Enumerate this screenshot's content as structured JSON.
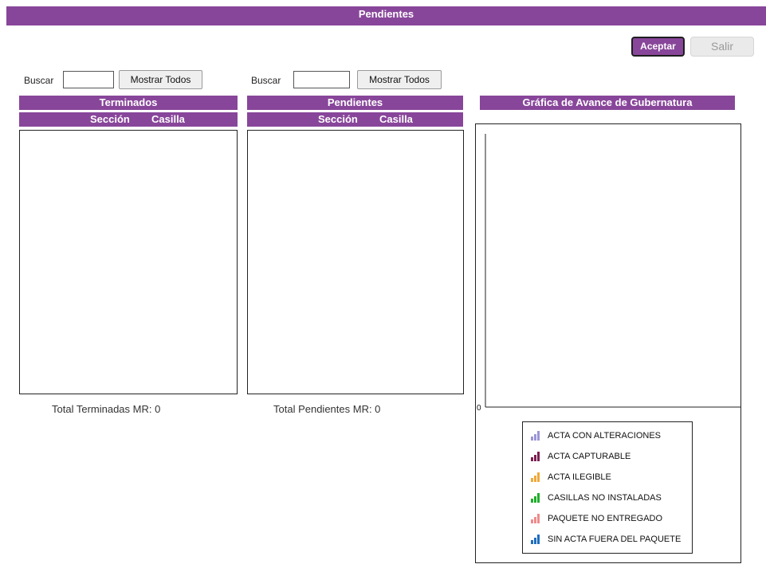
{
  "header": {
    "title": "Pendientes"
  },
  "actions": {
    "accept_label": "Aceptar",
    "exit_label": "Salir"
  },
  "terminados": {
    "search_label": "Buscar",
    "search_value": "",
    "show_all_label": "Mostrar Todos",
    "title": "Terminados",
    "col_seccion": "Sección",
    "col_casilla": "Casilla",
    "total_text": "Total Terminadas MR: 0"
  },
  "pendientes": {
    "search_label": "Buscar",
    "search_value": "",
    "show_all_label": "Mostrar Todos",
    "title": "Pendientes",
    "col_seccion": "Sección",
    "col_casilla": "Casilla",
    "total_text": "Total Pendientes MR: 0"
  },
  "chart_panel": {
    "title": "Gráfica de Avance de Gubernatura"
  },
  "chart_data": {
    "type": "bar",
    "title": "",
    "categories": [],
    "series": [
      {
        "name": "ACTA CON ALTERACIONES",
        "color": "#9b95d6",
        "values": []
      },
      {
        "name": "ACTA CAPTURABLE",
        "color": "#7a1f52",
        "values": []
      },
      {
        "name": "ACTA ILEGIBLE",
        "color": "#f0a93a",
        "values": []
      },
      {
        "name": "CASILLAS NO INSTALADAS",
        "color": "#1fae2a",
        "values": []
      },
      {
        "name": "PAQUETE NO ENTREGADO",
        "color": "#ef8b8b",
        "values": []
      },
      {
        "name": "SIN ACTA FUERA DEL PAQUETE",
        "color": "#1f6fbf",
        "values": []
      }
    ],
    "y_tick_labels": [
      "0"
    ],
    "legend_position": "bottom",
    "grid": false
  }
}
